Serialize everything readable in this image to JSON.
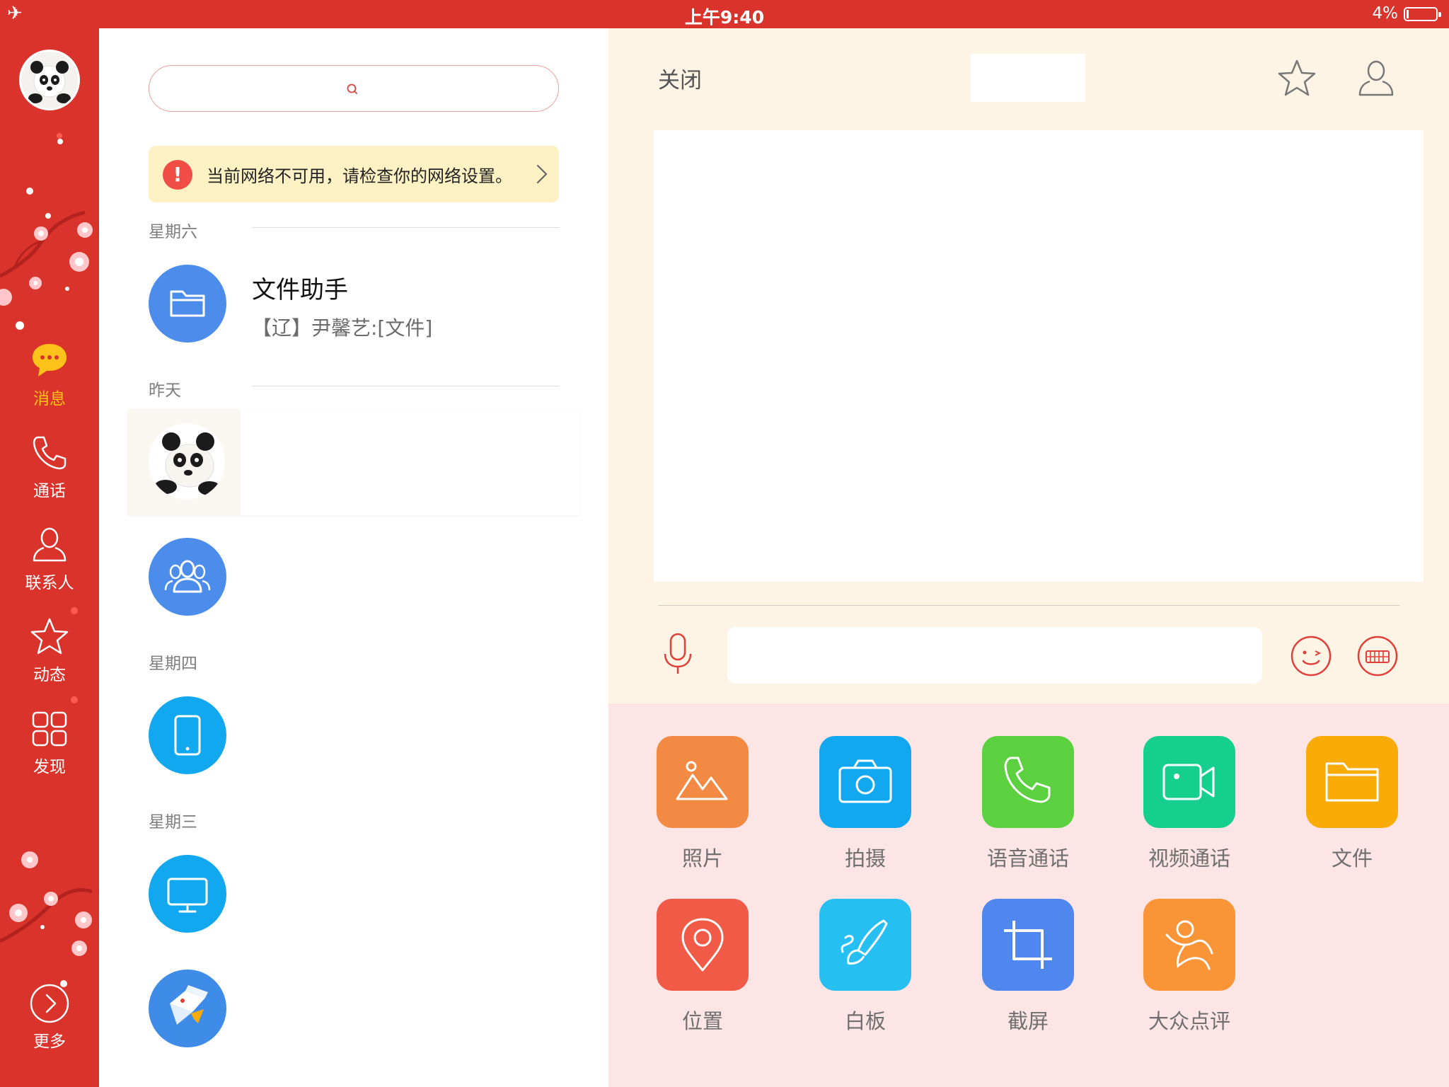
{
  "status_bar": {
    "time": "上午9:40",
    "battery": "4%",
    "airplane_icon": "airplane-icon",
    "battery_level": 0.04
  },
  "sidebar": {
    "nav": [
      {
        "label": "消息",
        "icon": "chat-bubble-icon",
        "active": true
      },
      {
        "label": "通话",
        "icon": "phone-icon",
        "active": false
      },
      {
        "label": "联系人",
        "icon": "person-icon",
        "active": false
      },
      {
        "label": "动态",
        "icon": "star-icon",
        "active": false
      },
      {
        "label": "发现",
        "icon": "grid-icon",
        "active": false
      }
    ],
    "more_label": "更多",
    "active_color": "#ffc21a",
    "bg_color": "#d9332b"
  },
  "list": {
    "search": {
      "placeholder": ""
    },
    "network_warning": "当前网络不可用，请检查你的网络设置。",
    "sections": {
      "saturday": "星期六",
      "yesterday": "昨天",
      "thursday": "星期四",
      "wednesday": "星期三"
    },
    "conversations": {
      "file_helper": {
        "title": "文件助手",
        "preview": "【辽】尹馨艺:[文件]"
      }
    }
  },
  "chat": {
    "close_label": "关闭",
    "message_input": {
      "placeholder": ""
    },
    "panel_color": "#fef4e5"
  },
  "tools": [
    {
      "label": "照片",
      "icon": "photo-icon",
      "color": "#f28a44"
    },
    {
      "label": "拍摄",
      "icon": "camera-icon",
      "color": "#12a8ef"
    },
    {
      "label": "语音通话",
      "icon": "phone-call-icon",
      "color": "#5bd13f"
    },
    {
      "label": "视频通话",
      "icon": "video-call-icon",
      "color": "#15cf8e"
    },
    {
      "label": "文件",
      "icon": "folder-icon",
      "color": "#f9ab08"
    },
    {
      "label": "位置",
      "icon": "location-icon",
      "color": "#f05a47"
    },
    {
      "label": "白板",
      "icon": "whiteboard-icon",
      "color": "#25bff2"
    },
    {
      "label": "截屏",
      "icon": "crop-icon",
      "color": "#4f87ee"
    },
    {
      "label": "大众点评",
      "icon": "dianping-icon",
      "color": "#f99537"
    }
  ]
}
